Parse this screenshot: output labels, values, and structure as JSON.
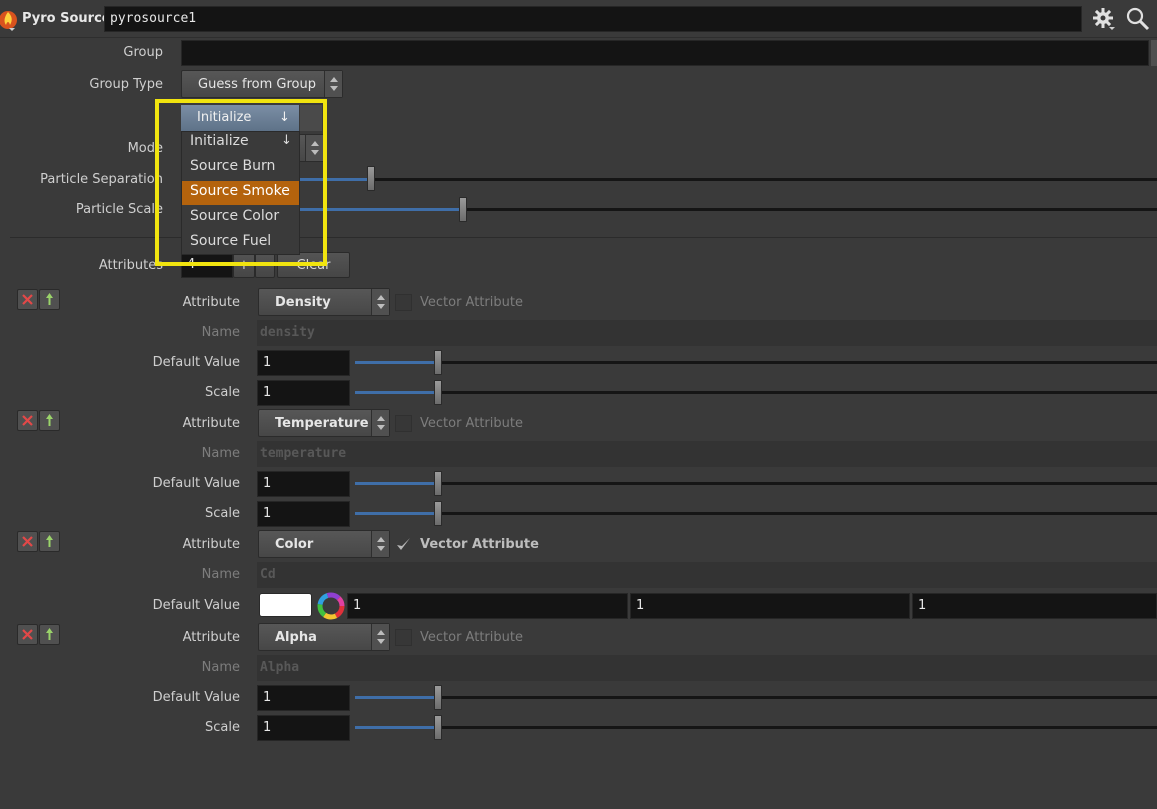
{
  "header": {
    "node_type": "Pyro Source",
    "node_name": "pyrosource1"
  },
  "params": {
    "group_label": "Group",
    "group_value": "",
    "group_type_label": "Group Type",
    "group_type_value": "Guess from Group",
    "mode_label": "Mode",
    "particle_separation_label": "Particle Separation",
    "particle_separation_fill": 0.33,
    "particle_scale_label": "Particle Scale",
    "particle_scale_fill": 0.62
  },
  "dropdown": {
    "current": "Initialize",
    "current_arrow": "↓",
    "options": [
      {
        "label": "Initialize",
        "arrow": "↓",
        "selected": false
      },
      {
        "label": "Source Burn",
        "arrow": "",
        "selected": false
      },
      {
        "label": "Source Smoke",
        "arrow": "",
        "selected": true
      },
      {
        "label": "Source Color",
        "arrow": "",
        "selected": false
      },
      {
        "label": "Source Fuel",
        "arrow": "",
        "selected": false
      }
    ]
  },
  "attributes": {
    "label": "Attributes",
    "count": "4",
    "add": "+",
    "remove": "-",
    "clear": "Clear",
    "items": [
      {
        "attribute_label": "Attribute",
        "attribute_value": "Density",
        "vector_label": "Vector Attribute",
        "vector_checked": false,
        "name_label": "Name",
        "name_value": "density",
        "default_label": "Default Value",
        "default_value": "1",
        "scale_label": "Scale",
        "scale_value": "1"
      },
      {
        "attribute_label": "Attribute",
        "attribute_value": "Temperature",
        "vector_label": "Vector Attribute",
        "vector_checked": false,
        "name_label": "Name",
        "name_value": "temperature",
        "default_label": "Default Value",
        "default_value": "1",
        "scale_label": "Scale",
        "scale_value": "1"
      },
      {
        "attribute_label": "Attribute",
        "attribute_value": "Color",
        "vector_label": "Vector Attribute",
        "vector_checked": true,
        "name_label": "Name",
        "name_value": "Cd",
        "default_label": "Default Value",
        "default_r": "1",
        "default_g": "1",
        "default_b": "1"
      },
      {
        "attribute_label": "Attribute",
        "attribute_value": "Alpha",
        "vector_label": "Vector Attribute",
        "vector_checked": false,
        "name_label": "Name",
        "name_value": "Alpha",
        "default_label": "Default Value",
        "default_value": "1",
        "scale_label": "Scale",
        "scale_value": "1"
      }
    ]
  },
  "colors": {
    "accent": "#b4630d",
    "highlight_box": "#f1e40f",
    "slider_fill": "#3f6ea8"
  }
}
